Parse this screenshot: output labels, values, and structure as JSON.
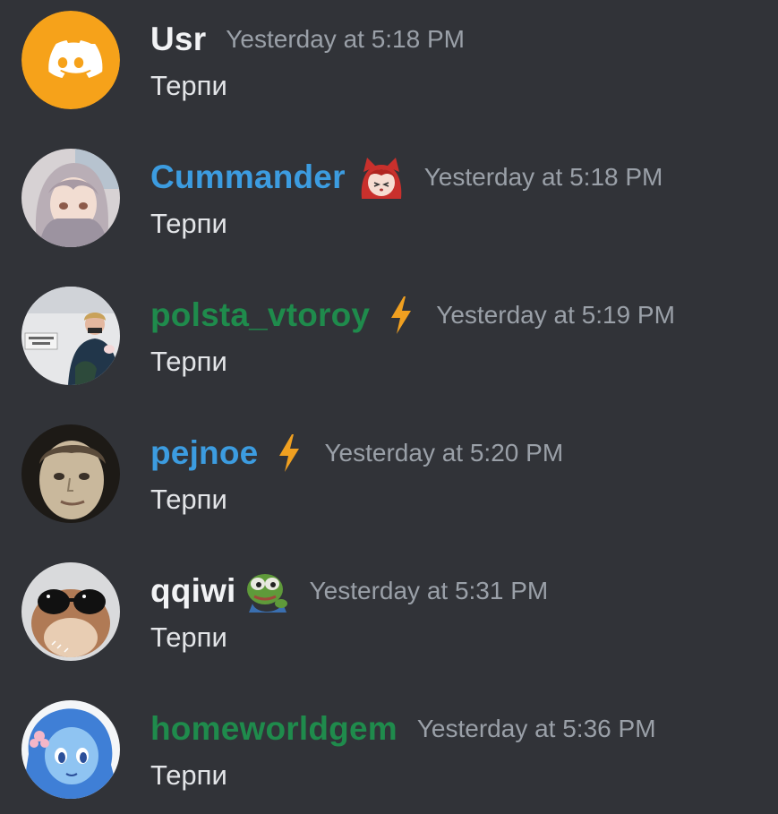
{
  "messages": [
    {
      "username": "Usr",
      "name_color": "#f2f3f5",
      "role_icon": "",
      "timestamp": "Yesterday at 5:18 PM",
      "text": "Терпи",
      "avatar": "discord-logo-icon"
    },
    {
      "username": "Cummander",
      "name_color": "#3c9ce0",
      "role_icon": "anime-girl-emoji-icon",
      "timestamp": "Yesterday at 5:18 PM",
      "text": "Терпи",
      "avatar": "anime-girl-avatar"
    },
    {
      "username": "polsta_vtoroy",
      "name_color": "#1f8b4c",
      "role_icon": "lightning-bolt-icon",
      "timestamp": "Yesterday at 5:19 PM",
      "text": "Терпи",
      "avatar": "photo-avatar"
    },
    {
      "username": "pejnoe",
      "name_color": "#3c9ce0",
      "role_icon": "lightning-bolt-icon",
      "timestamp": "Yesterday at 5:20 PM",
      "text": "Терпи",
      "avatar": "face-photo-avatar"
    },
    {
      "username": "qqiwi",
      "name_color": "#f2f3f5",
      "role_icon": "pepe-frog-emoji-icon",
      "timestamp": "Yesterday at 5:31 PM",
      "text": "Терпи",
      "avatar": "hamster-sunglasses-avatar"
    },
    {
      "username": "homeworldgem",
      "name_color": "#1f8b4c",
      "role_icon": "",
      "timestamp": "Yesterday at 5:36 PM",
      "text": "Терпи",
      "avatar": "blue-gem-character-avatar"
    }
  ],
  "colors": {
    "background": "#313338",
    "timestamp": "#9aa0a8",
    "text": "#e3e5e8",
    "bolt": "#f0a020",
    "discord_orange": "#f6a21a"
  }
}
